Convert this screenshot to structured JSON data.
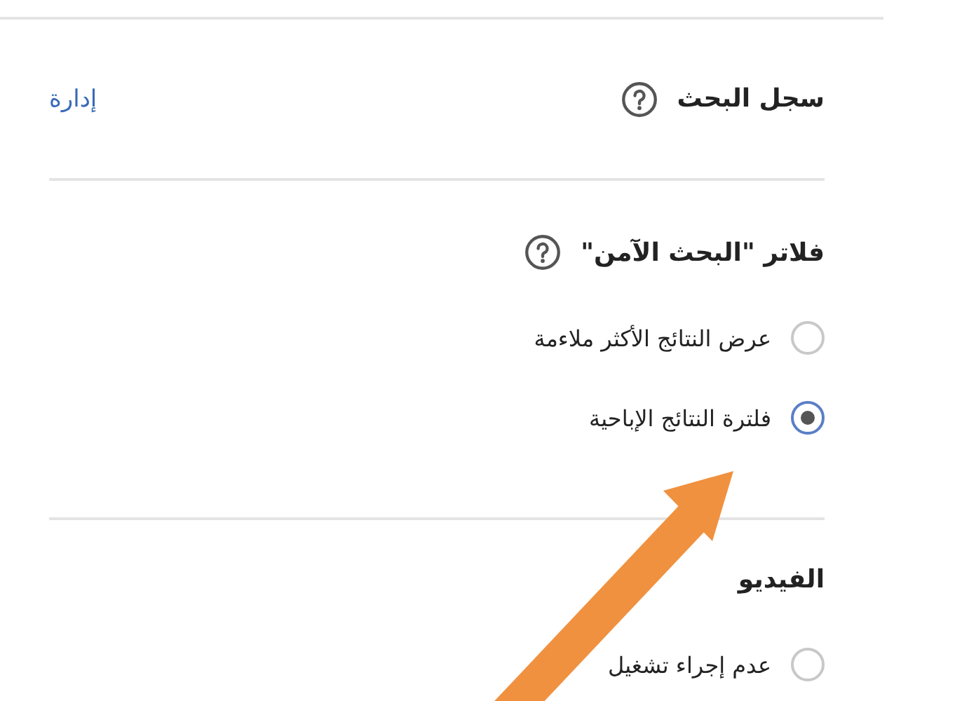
{
  "sections": [
    {
      "title": "سجل البحث",
      "help": true,
      "link": "إدارة"
    },
    {
      "title": "فلاتر \"البحث الآمن\"",
      "help": true,
      "options": [
        {
          "label": "عرض النتائج الأكثر ملاءمة",
          "selected": false
        },
        {
          "label": "فلترة النتائج الإباحية",
          "selected": true
        }
      ]
    },
    {
      "title": "الفيديو",
      "help": false,
      "options": [
        {
          "label": "عدم إجراء تشغيل",
          "selected": false
        }
      ]
    }
  ]
}
